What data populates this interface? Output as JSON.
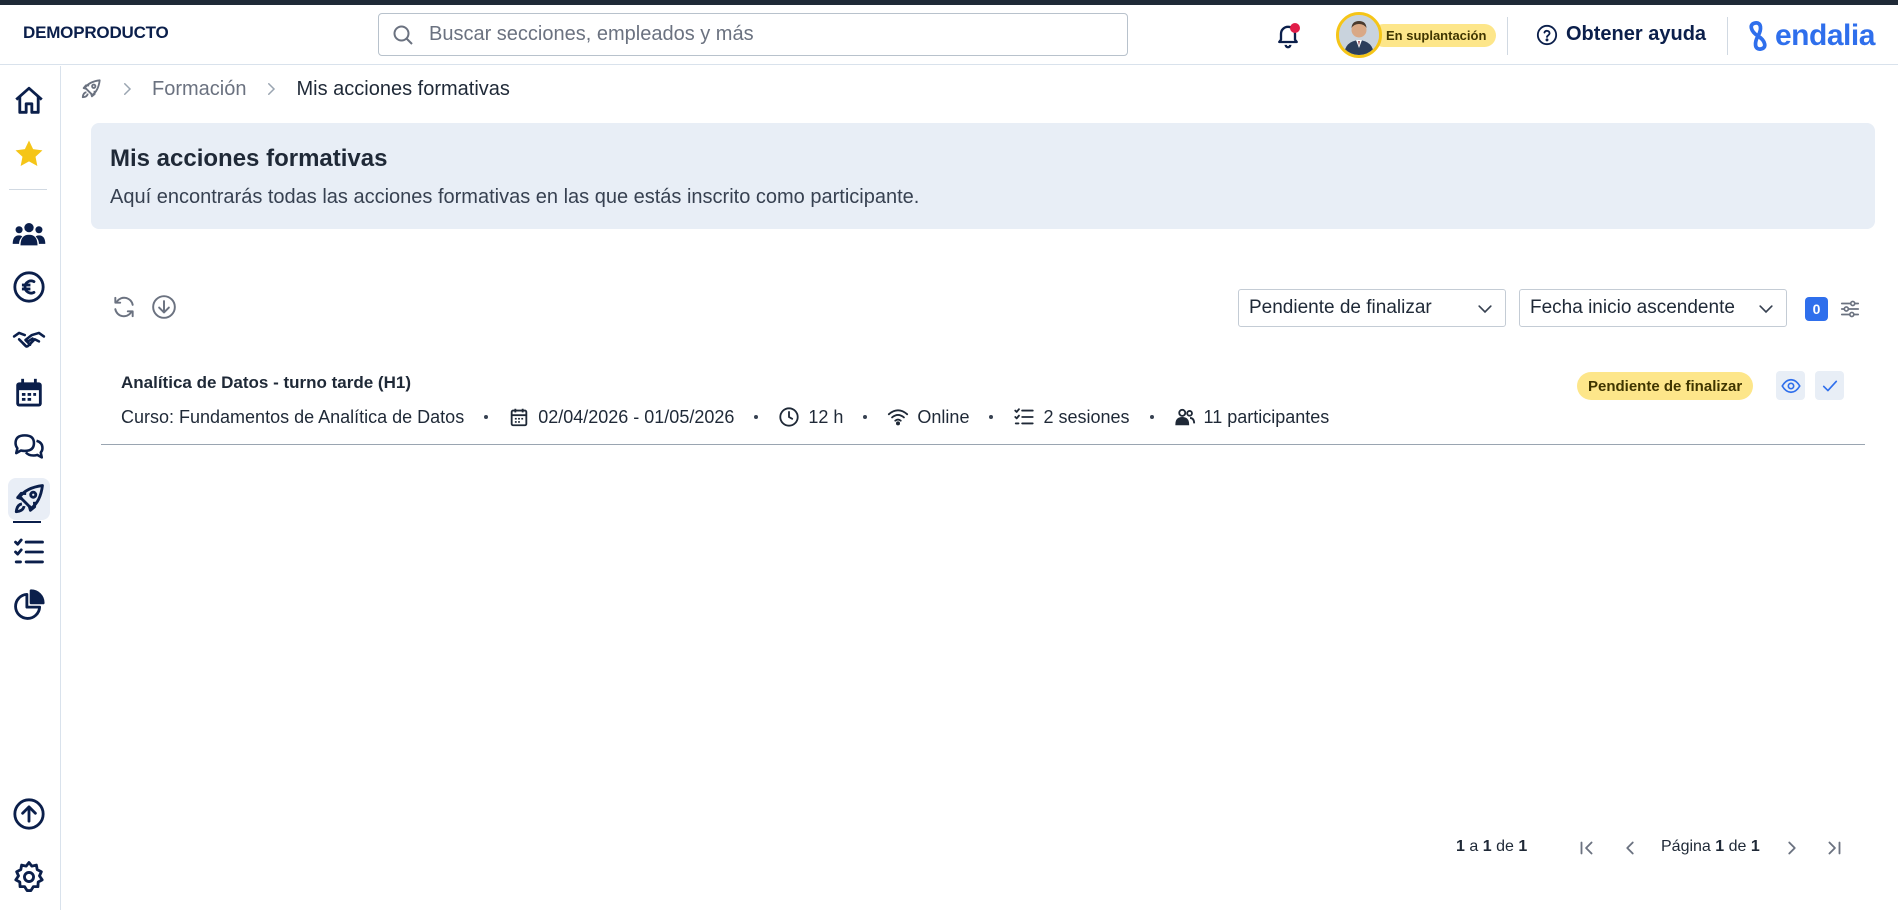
{
  "topbar": {
    "brand": "DEMOPRODUCTO",
    "search_placeholder": "Buscar secciones, empleados y más",
    "impersonation_badge": "En suplantación",
    "help_label": "Obtener ayuda",
    "logo_text": "endalia",
    "accent_color": "#2f6fec"
  },
  "sidebar": {
    "items": [
      {
        "name": "home",
        "icon": "home-icon"
      },
      {
        "name": "favorites",
        "icon": "star-icon"
      },
      {
        "name": "people",
        "icon": "people-icon"
      },
      {
        "name": "payroll",
        "icon": "euro-icon"
      },
      {
        "name": "agreements",
        "icon": "handshake-icon"
      },
      {
        "name": "calendar",
        "icon": "calendar-icon"
      },
      {
        "name": "chat",
        "icon": "chat-icon"
      },
      {
        "name": "training",
        "icon": "rocket-icon",
        "active": true
      },
      {
        "name": "tasks",
        "icon": "checklist-icon"
      },
      {
        "name": "reports",
        "icon": "pie-chart-icon"
      },
      {
        "name": "upload",
        "icon": "upload-icon"
      },
      {
        "name": "settings",
        "icon": "gear-icon"
      }
    ]
  },
  "breadcrumb": {
    "home_icon": "rocket-icon",
    "section": "Formación",
    "current": "Mis acciones formativas"
  },
  "header": {
    "title": "Mis acciones formativas",
    "description": "Aquí encontrarás todas las acciones formativas en las que estás inscrito como participante."
  },
  "toolbar": {
    "status_filter": "Pendiente de finalizar",
    "sort": "Fecha inicio ascendente",
    "filter_count": "0"
  },
  "rows": [
    {
      "title": "Analítica de Datos - turno tarde (H1)",
      "course": "Curso: Fundamentos de Analítica de Datos",
      "dates": "02/04/2026 - 01/05/2026",
      "duration": "12 h",
      "modality": "Online",
      "sessions": "2 sesiones",
      "participants": "11 participantes",
      "status": "Pendiente de finalizar"
    }
  ],
  "pagination": {
    "from": "1",
    "a": "a",
    "to": "1",
    "de": "de",
    "total": "1",
    "page_label": "Página",
    "page": "1",
    "page_de": "de",
    "pages": "1"
  }
}
